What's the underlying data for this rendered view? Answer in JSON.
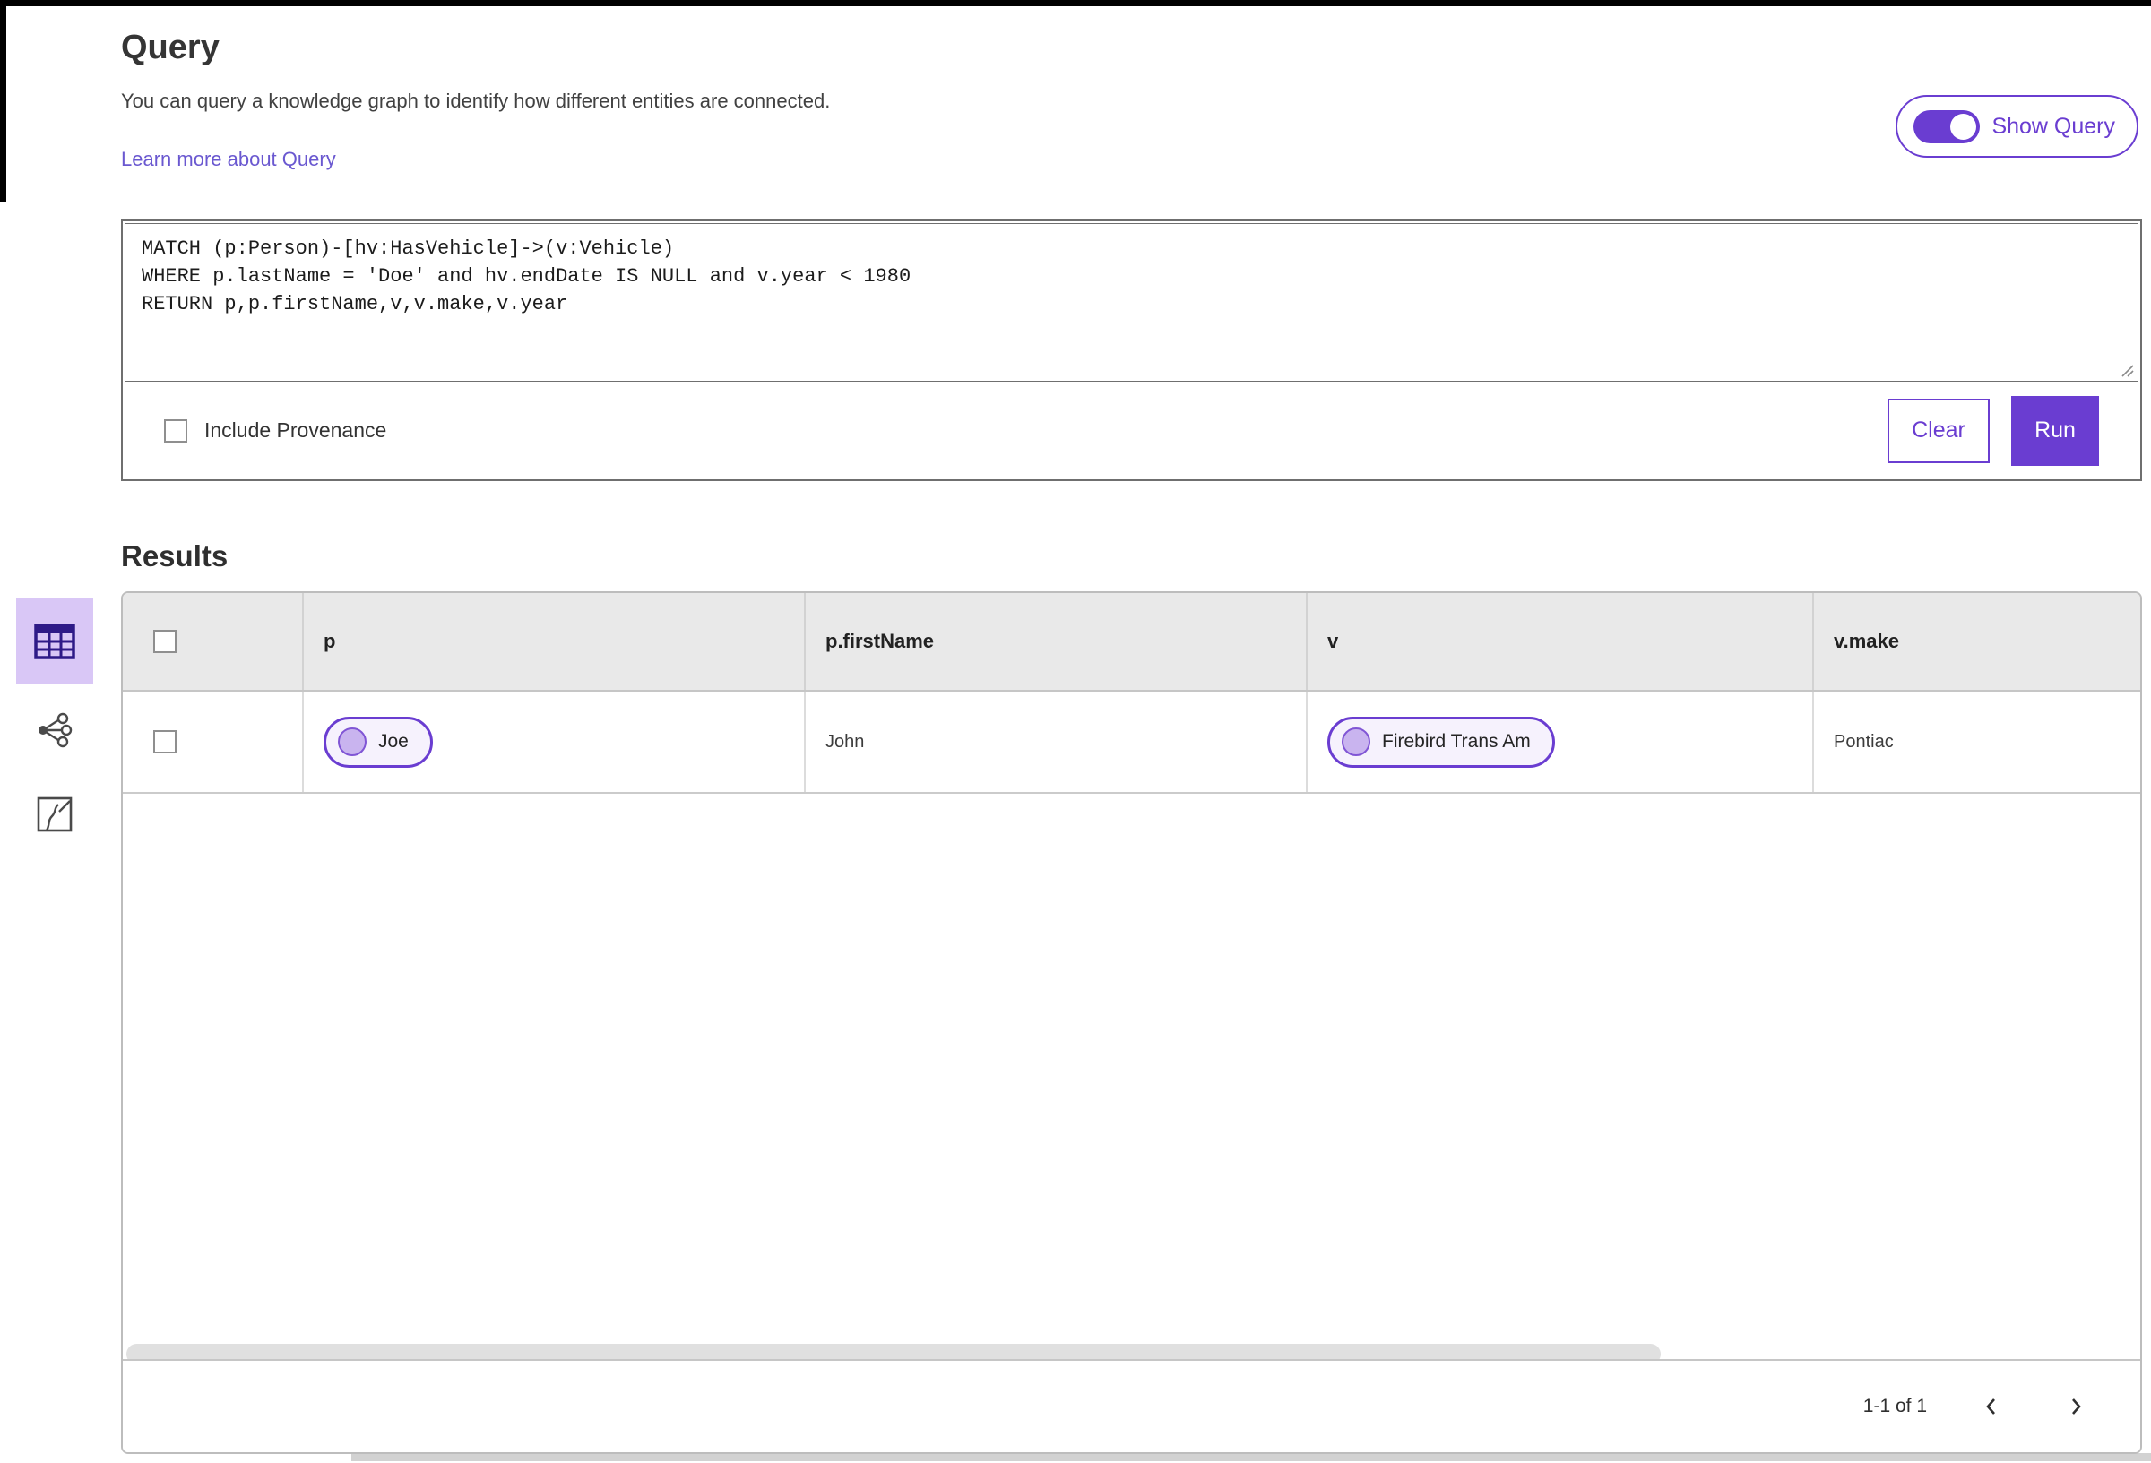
{
  "header": {
    "title": "Query",
    "description": "You can query a knowledge graph to identify how different entities are connected.",
    "learn_more_link": "Learn more about Query",
    "show_query_toggle": {
      "label": "Show Query",
      "enabled": true
    }
  },
  "query_editor": {
    "code": "MATCH (p:Person)-[hv:HasVehicle]->(v:Vehicle)\nWHERE p.lastName = 'Doe' and hv.endDate IS NULL and v.year < 1980\nRETURN p,p.firstName,v,v.make,v.year",
    "include_provenance": {
      "label": "Include Provenance",
      "checked": false
    },
    "buttons": {
      "clear": "Clear",
      "run": "Run"
    }
  },
  "results": {
    "heading": "Results",
    "view_switcher": [
      {
        "id": "table-view",
        "icon": "table-icon",
        "active": true
      },
      {
        "id": "graph-view",
        "icon": "network-icon",
        "active": false
      },
      {
        "id": "map-view",
        "icon": "map-icon",
        "active": false
      }
    ],
    "table": {
      "columns": [
        {
          "label": "p"
        },
        {
          "label": "p.firstName"
        },
        {
          "label": "v"
        },
        {
          "label": "v.make"
        }
      ],
      "rows": [
        {
          "p": {
            "type": "entity-chip",
            "label": "Joe"
          },
          "p_firstName": "John",
          "v": {
            "type": "entity-chip",
            "label": "Firebird Trans Am"
          },
          "v_make": "Pontiac"
        }
      ]
    },
    "pagination": {
      "range_label": "1-1 of 1"
    }
  },
  "colors": {
    "accent_purple": "#6a3dd1",
    "active_view_bg": "#d9c7f6",
    "chip_bg": "#f6f2fd",
    "chip_circle": "#c9b4ef",
    "header_row_bg": "#e9e9e9",
    "link": "#6a58d0"
  }
}
